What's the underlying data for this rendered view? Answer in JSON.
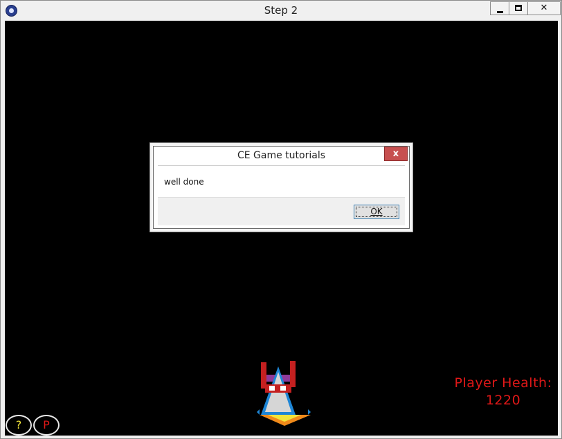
{
  "window": {
    "title": "Step 2",
    "icon": "paw-app-icon",
    "controls": {
      "minimize": "minimize-icon",
      "maximize": "maximize-icon",
      "close": "✕"
    }
  },
  "game": {
    "background_color": "#000000",
    "hud": {
      "health_label": "Player Health:",
      "health_value": "1220",
      "color": "#e01818"
    },
    "player_ship": {
      "icon": "spaceship-icon",
      "colors": [
        "#c42020",
        "#1e86d6",
        "#f3e53a",
        "#f08a1a"
      ]
    },
    "buttons": {
      "help": "?",
      "pause": "P"
    }
  },
  "dialog": {
    "title": "CE Game tutorials",
    "message": "well done",
    "ok_label": "OK",
    "close_label": "x",
    "close_color": "#c75050"
  }
}
